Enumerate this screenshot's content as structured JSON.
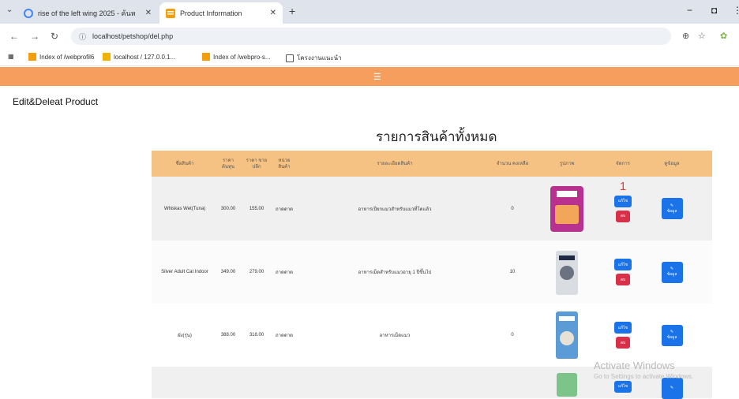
{
  "browser": {
    "tabs": [
      {
        "title": "rise of the left wing 2025 - ค้นห",
        "close": "✕"
      },
      {
        "title": "Product Information",
        "close": "✕"
      }
    ],
    "new_tab": "+",
    "window": {
      "minimize": "−",
      "restore": "◘",
      "menu": "⋮"
    },
    "address": {
      "url": "localhost/petshop/del.php"
    },
    "bookmarks": [
      {
        "label": "Index of /webprofil6"
      },
      {
        "label": "localhost / 127.0.0.1..."
      },
      {
        "label": "Index of /webpro-s..."
      },
      {
        "label": "โครงงานแนะนำ"
      }
    ]
  },
  "page": {
    "heading": "Edit&Deleat Product",
    "list_title": "รายการสินค้าทั้งหมด"
  },
  "table": {
    "headers": [
      "ชื่อสินค้า",
      "ราคา ต้นทุน",
      "ราคา ขายปลีก",
      "หน่วย สินค้า",
      "รายละเอียดสินค้า",
      "จำนวน คงเหลือ",
      "รูปภาพ",
      "จัดการ",
      "ดูข้อมูล"
    ],
    "rows": [
      {
        "name": "Whiskas Wet(Tuna)",
        "cost": "300.00",
        "price": "155.00",
        "unit": "ถาดดาด",
        "detail": "อาหารเปียกแมวสำหรับแมวที่โตแล้ว",
        "qty": "0",
        "image_color": "#b8318f"
      },
      {
        "name": "Silver Adult Cat Indoor",
        "cost": "349.00",
        "price": "279.00",
        "unit": "ถาดดาด",
        "detail": "อาหารเม็ดสำหรับแมวอายุ 1 ปีขึ้นไป",
        "qty": "10",
        "image_color": "#d9dde2"
      },
      {
        "name": "ผัง(รุ่น)",
        "cost": "388.00",
        "price": "318.00",
        "unit": "ถาดดาด",
        "detail": "อาหารเม็ดแมว",
        "qty": "0",
        "image_color": "#5b9cd6"
      },
      {
        "name": "",
        "cost": "",
        "price": "",
        "unit": "",
        "detail": "",
        "qty": "",
        "image_color": "#7cc48a"
      }
    ],
    "edit_label": "แก้ไข",
    "delete_label": "ลบ",
    "info_label": "ข้อมูล",
    "info_icon": "✎",
    "marker": "1"
  },
  "watermark": {
    "title": "Activate Windows",
    "subtitle": "Go to Settings to activate Windows."
  },
  "colors": {
    "orange_bar": "#f59e5e",
    "table_header": "#f6c283",
    "edit_button": "#1a73e8",
    "delete_button": "#d9304a"
  }
}
